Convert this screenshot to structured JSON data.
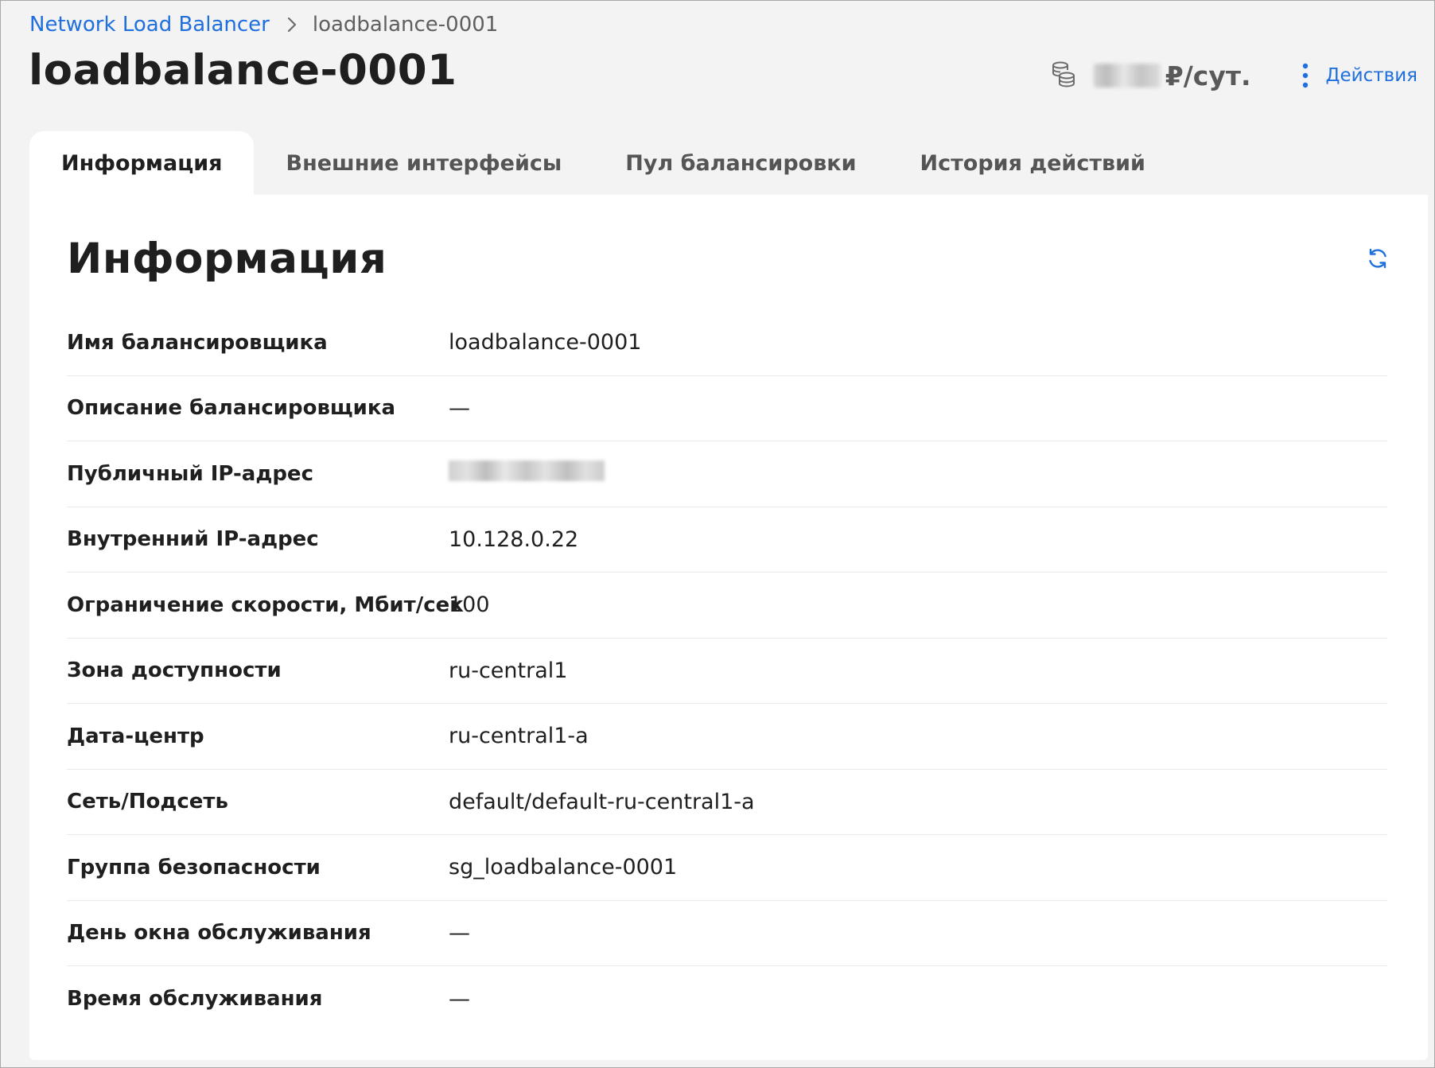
{
  "breadcrumb": {
    "parent": "Network Load Balancer",
    "current": "loadbalance-0001"
  },
  "page_title": "loadbalance-0001",
  "header": {
    "price_suffix": "₽/сут.",
    "actions_label": "Действия",
    "icons": [
      "coins-icon",
      "more-vertical-icon",
      "chevron-right-icon",
      "refresh-icon"
    ],
    "accent_color": "#1f6fde"
  },
  "tabs": [
    {
      "label": "Информация",
      "active": true
    },
    {
      "label": "Внешние интерфейсы",
      "active": false
    },
    {
      "label": "Пул балансировки",
      "active": false
    },
    {
      "label": "История действий",
      "active": false
    }
  ],
  "section": {
    "title": "Информация"
  },
  "info_rows": [
    {
      "label": "Имя балансировщика",
      "value": "loadbalance-0001"
    },
    {
      "label": "Описание балансировщика",
      "value": "—"
    },
    {
      "label": "Публичный IP-адрес",
      "value": ""
    },
    {
      "label": "Внутренний IP-адрес",
      "value": "10.128.0.22"
    },
    {
      "label": "Ограничение скорости, Мбит/сек",
      "value": "100"
    },
    {
      "label": "Зона доступности",
      "value": "ru-central1"
    },
    {
      "label": "Дата-центр",
      "value": "ru-central1-a"
    },
    {
      "label": "Сеть/Подсеть",
      "value": "default/default-ru-central1-a"
    },
    {
      "label": "Группа безопасности",
      "value": "sg_loadbalance-0001"
    },
    {
      "label": "День окна обслуживания",
      "value": "—"
    },
    {
      "label": "Время обслуживания",
      "value": "—"
    }
  ]
}
